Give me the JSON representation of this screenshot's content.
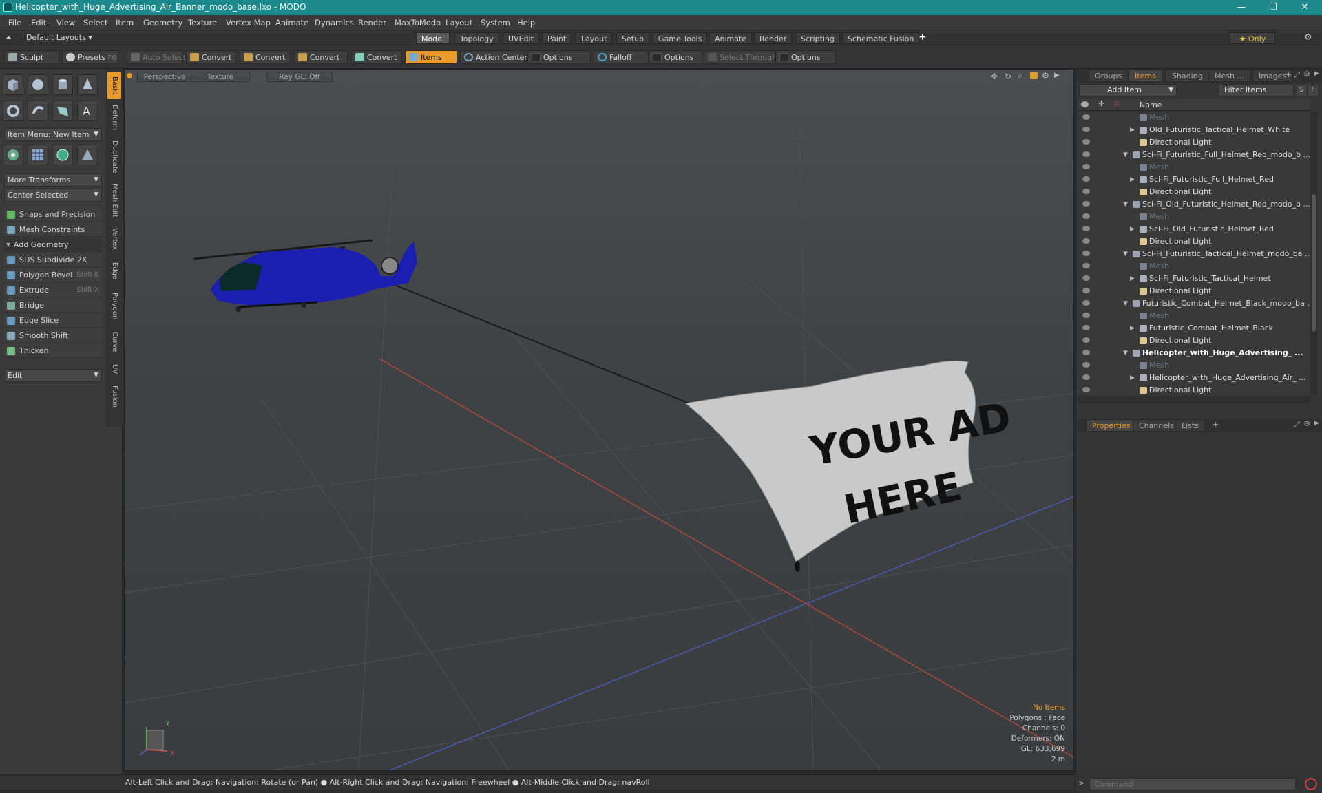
{
  "window": {
    "title": "Helicopter_with_Huge_Advertising_Air_Banner_modo_base.lxo - MODO",
    "minimize": "—",
    "maximize": "❐",
    "close": "✕"
  },
  "menu": [
    "File",
    "Edit",
    "View",
    "Select",
    "Item",
    "Geometry",
    "Texture",
    "Vertex Map",
    "Animate",
    "Dynamics",
    "Render",
    "MaxToModo",
    "Layout",
    "System",
    "Help"
  ],
  "layoutbar": {
    "layout_label": "Default Layouts ▾",
    "tabs": [
      "Model",
      "Topology",
      "UVEdit",
      "Paint",
      "Layout",
      "Setup",
      "Game Tools",
      "Animate",
      "Render",
      "Scripting",
      "Schematic Fusion"
    ],
    "active_tab": "Model",
    "plus": "+",
    "only": "★  Only",
    "gear": "⚙"
  },
  "toolbar": {
    "sculpt": "Sculpt",
    "presets": "Presets",
    "presets_shortcut": "F6",
    "auto_select": "Auto Select",
    "convert1": "Convert",
    "convert2": "Convert",
    "convert3": "Convert",
    "convert4": "Convert",
    "items": "Items",
    "action_center": "Action Center",
    "options1": "Options",
    "falloff": "Falloff",
    "options2": "Options",
    "select_through": "Select Through",
    "options3": "Options"
  },
  "left": {
    "side_tabs": [
      "Basic",
      "Deform",
      "Duplicate",
      "Mesh Edit",
      "Vertex",
      "Edge",
      "Polygon",
      "Curve",
      "UV",
      "Fusion"
    ],
    "item_menu": "Item Menu: New Item",
    "more_transforms": "More Transforms",
    "center_selected": "Center Selected",
    "snaps": "Snaps and Precision",
    "mesh_constraints": "Mesh Constraints",
    "add_geometry": "Add Geometry",
    "tools": [
      {
        "label": "SDS Subdivide 2X",
        "shortcut": ""
      },
      {
        "label": "Polygon Bevel",
        "shortcut": "Shift-B"
      },
      {
        "label": "Extrude",
        "shortcut": "Shift-X"
      },
      {
        "label": "Bridge",
        "shortcut": ""
      },
      {
        "label": "Edge Slice",
        "shortcut": ""
      },
      {
        "label": "Smooth Shift",
        "shortcut": ""
      },
      {
        "label": "Thicken",
        "shortcut": ""
      }
    ],
    "edit_dropdown": "Edit"
  },
  "viewport": {
    "perspective": "Perspective",
    "texture": "Texture",
    "raygl": "Ray GL: Off",
    "banner_line1": "YOUR AD",
    "banner_line2": "HERE",
    "hud": {
      "no_items": "No Items",
      "polygons": "Polygons : Face",
      "channels": "Channels: 0",
      "deformers": "Deformers: ON",
      "gl": "GL: 633,699",
      "scale": "2 m"
    },
    "axis_y": "Y",
    "axis_x": "X"
  },
  "status": "Alt-Left Click and Drag: Navigation: Rotate (or Pan) ● Alt-Right Click and Drag: Navigation: Freewheel ● Alt-Middle Click and Drag: navRoll",
  "right": {
    "tabs": [
      "Groups",
      "Items",
      "Shading",
      "Mesh ...",
      "Images"
    ],
    "active_tab": "Items",
    "add_item": "Add Item",
    "filter_items": "Filter Items",
    "s_btn": "S",
    "f_btn": "F",
    "name_header": "Name",
    "rows": [
      {
        "label": "Mesh",
        "indent": 2,
        "type": "mesh",
        "twisty": "",
        "dim": true
      },
      {
        "label": "Old_Futuristic_Tactical_Helmet_White",
        "indent": 2,
        "type": "locator",
        "twisty": "▶"
      },
      {
        "label": "Directional Light",
        "indent": 2,
        "type": "light",
        "twisty": ""
      },
      {
        "label": "Sci-Fi_Futuristic_Full_Helmet_Red_modo_b ...",
        "indent": 1,
        "type": "scene",
        "twisty": "▼"
      },
      {
        "label": "Mesh",
        "indent": 2,
        "type": "mesh",
        "twisty": "",
        "dim": true
      },
      {
        "label": "Sci-Fi_Futuristic_Full_Helmet_Red",
        "indent": 2,
        "type": "locator",
        "twisty": "▶"
      },
      {
        "label": "Directional Light",
        "indent": 2,
        "type": "light",
        "twisty": ""
      },
      {
        "label": "Sci-Fi_Old_Futuristic_Helmet_Red_modo_b ...",
        "indent": 1,
        "type": "scene",
        "twisty": "▼"
      },
      {
        "label": "Mesh",
        "indent": 2,
        "type": "mesh",
        "twisty": "",
        "dim": true
      },
      {
        "label": "Sci-Fi_Old_Futuristic_Helmet_Red",
        "indent": 2,
        "type": "locator",
        "twisty": "▶"
      },
      {
        "label": "Directional Light",
        "indent": 2,
        "type": "light",
        "twisty": ""
      },
      {
        "label": "Sci-Fi_Futuristic_Tactical_Helmet_modo_ba ...",
        "indent": 1,
        "type": "scene",
        "twisty": "▼"
      },
      {
        "label": "Mesh",
        "indent": 2,
        "type": "mesh",
        "twisty": "",
        "dim": true
      },
      {
        "label": "Sci-Fi_Futuristic_Tactical_Helmet",
        "indent": 2,
        "type": "locator",
        "twisty": "▶"
      },
      {
        "label": "Directional Light",
        "indent": 2,
        "type": "light",
        "twisty": ""
      },
      {
        "label": "Futuristic_Combat_Helmet_Black_modo_ba ...",
        "indent": 1,
        "type": "scene",
        "twisty": "▼"
      },
      {
        "label": "Mesh",
        "indent": 2,
        "type": "mesh",
        "twisty": "",
        "dim": true
      },
      {
        "label": "Futuristic_Combat_Helmet_Black",
        "indent": 2,
        "type": "locator",
        "twisty": "▶"
      },
      {
        "label": "Directional Light",
        "indent": 2,
        "type": "light",
        "twisty": ""
      },
      {
        "label": "Helicopter_with_Huge_Advertising_ ...",
        "indent": 1,
        "type": "scene",
        "twisty": "▼",
        "bold": true
      },
      {
        "label": "Mesh",
        "indent": 2,
        "type": "mesh",
        "twisty": "",
        "dim": true
      },
      {
        "label": "Helicopter_with_Huge_Advertising_Air_ ...",
        "indent": 2,
        "type": "locator",
        "twisty": "▶"
      },
      {
        "label": "Directional Light",
        "indent": 2,
        "type": "light",
        "twisty": ""
      }
    ],
    "bottom_tabs": [
      "Properties",
      "Channels",
      "Lists"
    ],
    "bottom_active": "Properties",
    "bottom_plus": "+",
    "command_placeholder": "Command"
  },
  "colors": {
    "accent": "#e89a2a",
    "title_bar": "#1c8a8c",
    "helicopter": "#1a1fb0",
    "banner": "#c9c9c9"
  }
}
